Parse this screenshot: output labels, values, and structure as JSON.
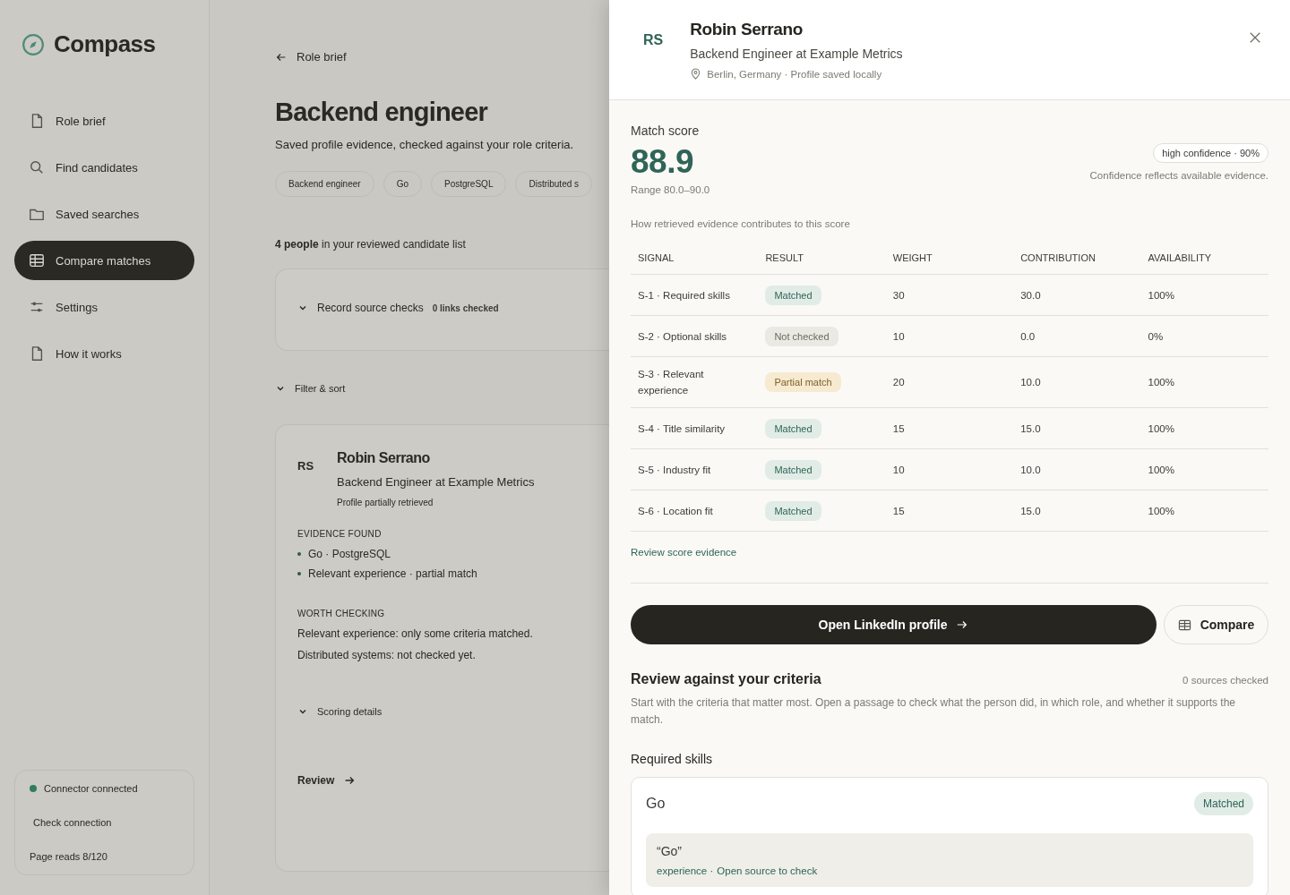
{
  "sidebar": {
    "brand": "Compass",
    "items": [
      {
        "label": "Role brief",
        "selected": false
      },
      {
        "label": "Find candidates",
        "selected": false
      },
      {
        "label": "Saved searches",
        "selected": false
      },
      {
        "label": "Compare matches",
        "selected": true
      },
      {
        "label": "Settings",
        "selected": false
      },
      {
        "label": "How it works",
        "selected": false
      }
    ],
    "connector": {
      "status": "Connector connected",
      "color": "#2f7d5b",
      "action": "Check connection",
      "usage": "Page reads 8/120"
    }
  },
  "main": {
    "back": "Role brief",
    "title": "Backend engineer",
    "subtitle": "Saved profile evidence, checked against your role criteria.",
    "chips": [
      "Backend engineer",
      "Go",
      "PostgreSQL",
      "Distributed s"
    ],
    "count": "**4 people** in your reviewed candidate list",
    "source_checks": {
      "label": "Record source checks",
      "count": "0 links checked"
    },
    "filter": "Filter & sort",
    "card": {
      "initials": "RS",
      "name": "Robin Serrano",
      "role": "Backend Engineer at Example Metrics",
      "note": "Profile partially retrieved",
      "evidence_heading": "EVIDENCE FOUND",
      "evidence": [
        "Go · PostgreSQL",
        "Relevant experience · partial match"
      ],
      "worth_heading": "WORTH CHECKING",
      "worth": [
        "Relevant experience: only some criteria matched.",
        "Distributed systems: not checked yet."
      ],
      "details": "Scoring details",
      "review": "Review"
    }
  },
  "panel": {
    "initials": "RS",
    "name": "Robin Serrano",
    "role": "Backend Engineer at Example Metrics",
    "location": "Berlin, Germany · Profile saved locally",
    "score_label": "Match score",
    "score": "88.9",
    "range": "Range 80.0–90.0",
    "confidence": "high confidence · 90%",
    "confidence_note": "Confidence reflects available evidence.",
    "table_caption": "How retrieved evidence contributes to this score",
    "table": {
      "columns": [
        "SIGNAL",
        "RESULT",
        "WEIGHT",
        "CONTRIBUTION",
        "AVAILABILITY"
      ],
      "rows": [
        {
          "signal": "S-1 · Required skills",
          "result": "Matched",
          "kind": "matched",
          "weight": "30",
          "contribution": "30.0",
          "availability": "100%"
        },
        {
          "signal": "S-2 · Optional skills",
          "result": "Not checked",
          "kind": "unchecked",
          "weight": "10",
          "contribution": "0.0",
          "availability": "0%"
        },
        {
          "signal": "S-3 · Relevant experience",
          "result": "Partial match",
          "kind": "partial",
          "weight": "20",
          "contribution": "10.0",
          "availability": "100%"
        },
        {
          "signal": "S-4 · Title similarity",
          "result": "Matched",
          "kind": "matched",
          "weight": "15",
          "contribution": "15.0",
          "availability": "100%"
        },
        {
          "signal": "S-5 · Industry fit",
          "result": "Matched",
          "kind": "matched",
          "weight": "10",
          "contribution": "10.0",
          "availability": "100%"
        },
        {
          "signal": "S-6 · Location fit",
          "result": "Matched",
          "kind": "matched",
          "weight": "15",
          "contribution": "15.0",
          "availability": "100%"
        }
      ]
    },
    "evidence_link": "Review score evidence",
    "primary": "Open LinkedIn profile",
    "secondary": "Compare",
    "review_title": "Review against your criteria",
    "sources": "0 sources checked",
    "review_text": "Start with the criteria that matter most. Open a passage to check what the person did, in which role, and whether it supports the match.",
    "section": "Required skills",
    "criterion": {
      "name": "Go",
      "result": "Matched",
      "kind": "matched",
      "quote": "“Go”",
      "source_type": "experience ·",
      "source_link": "Open source to check"
    }
  }
}
